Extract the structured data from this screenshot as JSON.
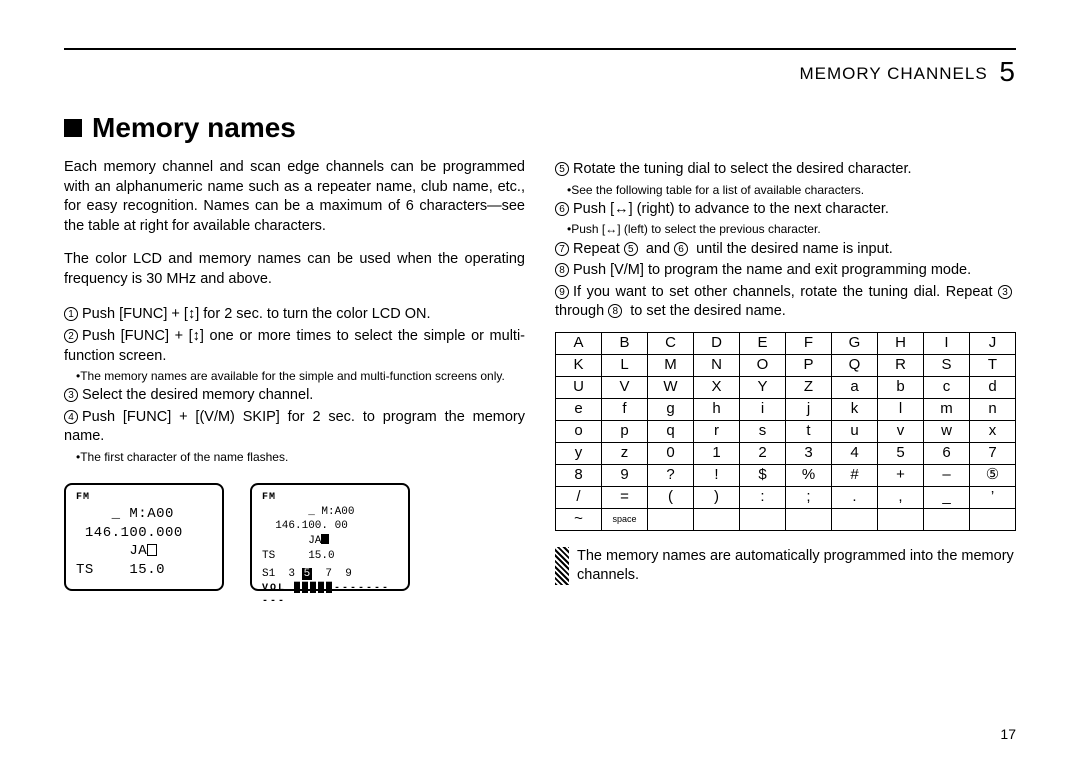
{
  "header": {
    "section": "MEMORY CHANNELS",
    "chapter": "5"
  },
  "title": "Memory names",
  "left": {
    "p1": "Each memory channel and scan edge channels can be programmed with an alphanumeric name such as a repeater name, club name, etc., for easy recognition. Names can be a maximum of 6 characters—see the table at right for available characters.",
    "p2": "The color LCD and memory names can be used when the operating frequency is 30 MHz and above.",
    "s1": "Push [FUNC] + [↕] for 2 sec. to turn the color LCD ON.",
    "s2": "Push [FUNC] + [↕] one or more times to select the simple or multi-function screen.",
    "n1": "•The memory names are available for the simple and multi-function screens only.",
    "s3": "Select the desired memory channel.",
    "s4": "Push [FUNC] + [(V/M) SKIP] for 2 sec. to program the memory name.",
    "n2": "•The first character of the name flashes."
  },
  "right": {
    "s5": "Rotate the tuning dial to select the desired character.",
    "n5": "•See the following table for a list of available characters.",
    "s6": "Push [↔] (right) to advance to the next character.",
    "n6": "•Push [↔] (left) to select the previous character.",
    "s7a": "Repeat ",
    "s7b": " and ",
    "s7c": " until the desired name is input.",
    "s8": "Push [V/M] to program the name and exit programming mode.",
    "s9a": "If you want to set other channels, rotate the tuning dial. Repeat ",
    "s9b": " through ",
    "s9c": " to set the desired name.",
    "hatched": "The memory names are automatically programmed into the memory channels."
  },
  "lcd1": {
    "fm": "FM",
    "l1": "    _ M:A00",
    "l2": " 146.100.000",
    "l3": "      JA",
    "l4": "TS    15.0"
  },
  "lcd2": {
    "fm": "FM",
    "l1": "       _ M:A00",
    "l2": "  146.100. 00",
    "l3": "       JA",
    "l4": "TS     15.0",
    "sig": "S1  3  5  7  9",
    "vol": "VOL █████----------"
  },
  "char_table": [
    [
      "A",
      "B",
      "C",
      "D",
      "E",
      "F",
      "G",
      "H",
      "I",
      "J"
    ],
    [
      "K",
      "L",
      "M",
      "N",
      "O",
      "P",
      "Q",
      "R",
      "S",
      "T"
    ],
    [
      "U",
      "V",
      "W",
      "X",
      "Y",
      "Z",
      "a",
      "b",
      "c",
      "d"
    ],
    [
      "e",
      "f",
      "g",
      "h",
      "i",
      "j",
      "k",
      "l",
      "m",
      "n"
    ],
    [
      "o",
      "p",
      "q",
      "r",
      "s",
      "t",
      "u",
      "v",
      "w",
      "x"
    ],
    [
      "y",
      "z",
      "0",
      "1",
      "2",
      "3",
      "4",
      "5",
      "6",
      "7"
    ],
    [
      "8",
      "9",
      "?",
      "!",
      "$",
      "%",
      "#",
      "+",
      "–",
      "⑤"
    ],
    [
      "/",
      "=",
      "(",
      ")",
      ":",
      ";",
      ".",
      ",",
      "_",
      "’"
    ],
    [
      "~",
      "space",
      "",
      "",
      "",
      "",
      "",
      "",
      "",
      ""
    ]
  ],
  "page": "17"
}
